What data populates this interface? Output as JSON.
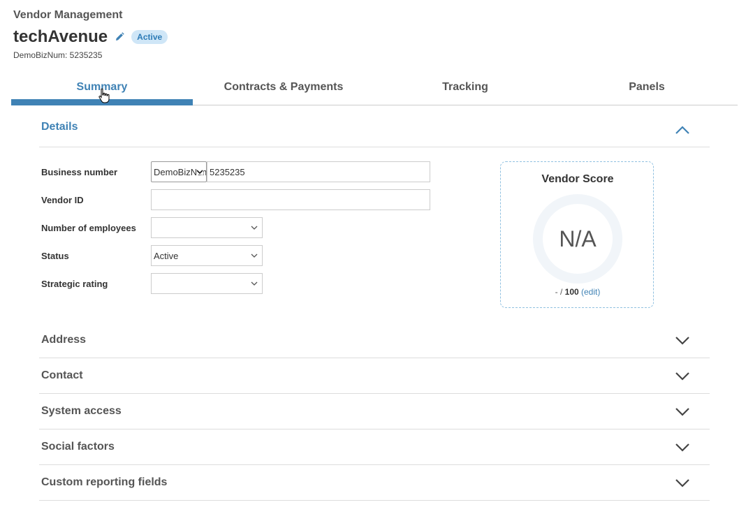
{
  "header": {
    "breadcrumb": "Vendor Management",
    "vendor_name": "techAvenue",
    "status_badge": "Active",
    "biz_num": "DemoBizNum: 5235235"
  },
  "tabs": [
    {
      "label": "Summary",
      "active": true
    },
    {
      "label": "Contracts & Payments",
      "active": false
    },
    {
      "label": "Tracking",
      "active": false
    },
    {
      "label": "Panels",
      "active": false
    }
  ],
  "details": {
    "title": "Details",
    "business_number": {
      "label": "Business number",
      "prefix": "DemoBizNum",
      "value": "5235235"
    },
    "vendor_id": {
      "label": "Vendor ID",
      "value": ""
    },
    "employees": {
      "label": "Number of employees",
      "value": ""
    },
    "status": {
      "label": "Status",
      "value": "Active"
    },
    "strategic_rating": {
      "label": "Strategic rating",
      "value": ""
    }
  },
  "vendor_score": {
    "title": "Vendor Score",
    "value": "N/A",
    "score": "-",
    "separator": " / ",
    "max": "100",
    "edit_label": "(edit)"
  },
  "sections": [
    "Address",
    "Contact",
    "System access",
    "Social factors",
    "Custom reporting fields"
  ],
  "colors": {
    "accent": "#3f82b5",
    "badge_bg": "#cfe6f7"
  }
}
